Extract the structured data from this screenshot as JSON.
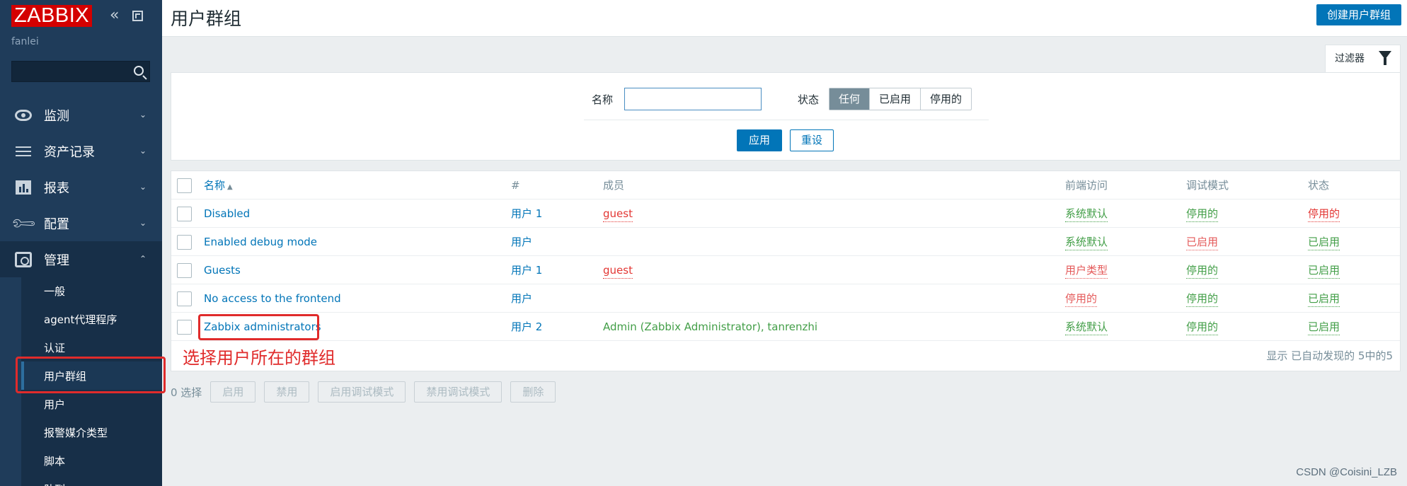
{
  "sidebar": {
    "logo": "ZABBIX",
    "server_name": "fanlei",
    "search_placeholder": "",
    "menu": [
      {
        "label": "监测",
        "icon": "eye-icon"
      },
      {
        "label": "资产记录",
        "icon": "list-icon"
      },
      {
        "label": "报表",
        "icon": "report-icon"
      },
      {
        "label": "配置",
        "icon": "wrench-icon"
      },
      {
        "label": "管理",
        "icon": "admin-icon"
      }
    ],
    "submenu": [
      "一般",
      "agent代理程序",
      "认证",
      "用户群组",
      "用户",
      "报警媒介类型",
      "脚本",
      "队列"
    ]
  },
  "header": {
    "title": "用户群组",
    "create_button": "创建用户群组"
  },
  "filter": {
    "tab_label": "过滤器",
    "name_label": "名称",
    "name_value": "",
    "status_label": "状态",
    "status_options": [
      "任何",
      "已启用",
      "停用的"
    ],
    "status_selected": "任何",
    "apply": "应用",
    "reset": "重设"
  },
  "table": {
    "columns": {
      "name": "名称",
      "sort_arrow": "▲",
      "count": "#",
      "members": "成员",
      "frontend": "前端访问",
      "debug": "调试模式",
      "status": "状态"
    },
    "rows": [
      {
        "name": "Disabled",
        "count": "用户 1",
        "members": "guest",
        "frontend": "系统默认",
        "debug": "停用的",
        "status": "停用的"
      },
      {
        "name": "Enabled debug mode",
        "count": "用户",
        "members": "",
        "frontend": "系统默认",
        "debug": "已启用",
        "status": "已启用"
      },
      {
        "name": "Guests",
        "count": "用户 1",
        "members": "guest",
        "frontend": "用户类型",
        "debug": "停用的",
        "status": "已启用"
      },
      {
        "name": "No access to the frontend",
        "count": "用户",
        "members": "",
        "frontend": "停用的",
        "debug": "停用的",
        "status": "已启用"
      },
      {
        "name": "Zabbix administrators",
        "count": "用户 2",
        "members": "Admin (Zabbix Administrator), tanrenzhi",
        "frontend": "系统默认",
        "debug": "停用的",
        "status": "已启用"
      }
    ],
    "summary": "显示 已自动发现的 5中的5"
  },
  "annotation": "选择用户所在的群组",
  "bulk": {
    "count": "0 选择",
    "buttons": [
      "启用",
      "禁用",
      "启用调试模式",
      "禁用调试模式",
      "删除"
    ]
  },
  "watermark": "CSDN @Coisini_LZB",
  "colors": {
    "sidebar_bg": "#1f3c5a",
    "accent": "#0275b8",
    "enabled_green": "#429e47",
    "disabled_red": "#e33734",
    "annotation_red": "#e02b2b"
  }
}
